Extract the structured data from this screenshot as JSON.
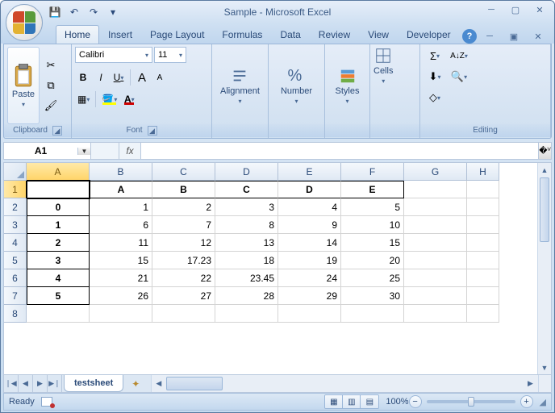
{
  "window": {
    "title": "Sample - Microsoft Excel"
  },
  "qat": {
    "save": "💾",
    "undo": "↶",
    "redo": "↷",
    "dd": "▾"
  },
  "tabs": [
    "Home",
    "Insert",
    "Page Layout",
    "Formulas",
    "Data",
    "Review",
    "View",
    "Developer"
  ],
  "active_tab": "Home",
  "ribbon": {
    "clipboard": {
      "label": "Clipboard",
      "paste": "Paste"
    },
    "font": {
      "label": "Font",
      "name": "Calibri",
      "size": "11",
      "bold": "B",
      "italic": "I",
      "underline": "U",
      "grow": "A",
      "shrink": "A"
    },
    "alignment": {
      "label": "Alignment"
    },
    "number": {
      "label": "Number",
      "pct": "%"
    },
    "styles": {
      "label": "Styles"
    },
    "cells": {
      "label": "Cells"
    },
    "editing": {
      "label": "Editing",
      "sum": "Σ",
      "sort": "A↓Z"
    }
  },
  "namebox": "A1",
  "fx": "fx",
  "formula_value": "",
  "columns": [
    "A",
    "B",
    "C",
    "D",
    "E",
    "F",
    "G",
    "H"
  ],
  "rows": [
    "1",
    "2",
    "3",
    "4",
    "5",
    "6",
    "7",
    "8"
  ],
  "sheet": {
    "r1": {
      "A": "",
      "B": "A",
      "C": "B",
      "D": "C",
      "E": "D",
      "F": "E"
    },
    "r2": {
      "A": "0",
      "B": "1",
      "C": "2",
      "D": "3",
      "E": "4",
      "F": "5"
    },
    "r3": {
      "A": "1",
      "B": "6",
      "C": "7",
      "D": "8",
      "E": "9",
      "F": "10"
    },
    "r4": {
      "A": "2",
      "B": "11",
      "C": "12",
      "D": "13",
      "E": "14",
      "F": "15"
    },
    "r5": {
      "A": "3",
      "B": "15",
      "C": "17.23",
      "D": "18",
      "E": "19",
      "F": "20"
    },
    "r6": {
      "A": "4",
      "B": "21",
      "C": "22",
      "D": "23.45",
      "E": "24",
      "F": "25"
    },
    "r7": {
      "A": "5",
      "B": "26",
      "C": "27",
      "D": "28",
      "E": "29",
      "F": "30"
    }
  },
  "sheet_tab": "testsheet",
  "status": {
    "ready": "Ready",
    "zoom": "100%"
  },
  "chart_data": {
    "type": "table",
    "columns": [
      "A",
      "B",
      "C",
      "D",
      "E"
    ],
    "index": [
      0,
      1,
      2,
      3,
      4,
      5
    ],
    "data": [
      [
        1,
        2,
        3,
        4,
        5
      ],
      [
        6,
        7,
        8,
        9,
        10
      ],
      [
        11,
        12,
        13,
        14,
        15
      ],
      [
        15,
        17.23,
        18,
        19,
        20
      ],
      [
        21,
        22,
        23.45,
        24,
        25
      ],
      [
        26,
        27,
        28,
        29,
        30
      ]
    ]
  }
}
